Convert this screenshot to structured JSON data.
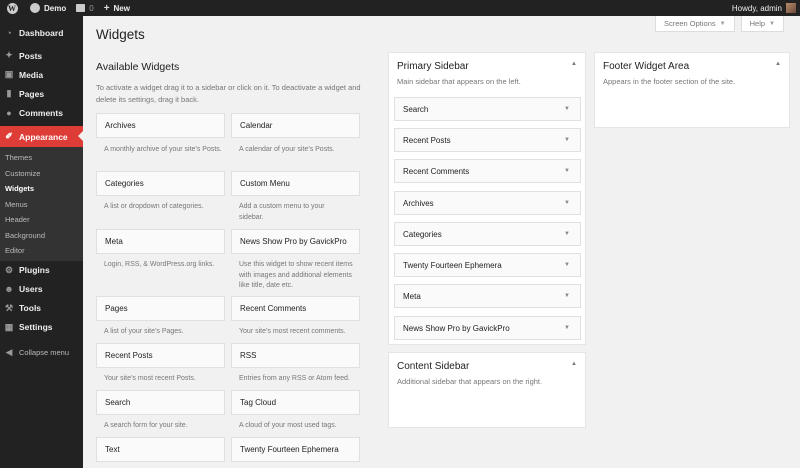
{
  "adminbar": {
    "site_name": "Demo",
    "comments_count": "0",
    "new_label": "New",
    "howdy": "Howdy, admin"
  },
  "sidebar": {
    "items_top": [
      {
        "label": "Dashboard",
        "icon": "dashboard-icon"
      }
    ],
    "items_mid": [
      {
        "label": "Posts",
        "icon": "pin-icon"
      },
      {
        "label": "Media",
        "icon": "media-icon"
      },
      {
        "label": "Pages",
        "icon": "page-icon"
      },
      {
        "label": "Comments",
        "icon": "comment-icon"
      }
    ],
    "appearance": "Appearance",
    "submenu": [
      "Themes",
      "Customize",
      "Widgets",
      "Menus",
      "Header",
      "Background",
      "Editor"
    ],
    "items_bottom": [
      {
        "label": "Plugins",
        "icon": "plugin-icon"
      },
      {
        "label": "Users",
        "icon": "user-icon"
      },
      {
        "label": "Tools",
        "icon": "wrench-icon"
      },
      {
        "label": "Settings",
        "icon": "settings-icon"
      }
    ],
    "collapse": "Collapse menu"
  },
  "screen_options": "Screen Options",
  "help": "Help",
  "page_title": "Widgets",
  "available": {
    "title": "Available Widgets",
    "description": "To activate a widget drag it to a sidebar or click on it. To deactivate a widget and delete its settings, drag it back.",
    "widgets": [
      {
        "name": "Archives",
        "desc": "A monthly archive of your site’s Posts."
      },
      {
        "name": "Calendar",
        "desc": "A calendar of your site’s Posts."
      },
      {
        "name": "Categories",
        "desc": "A list or dropdown of categories."
      },
      {
        "name": "Custom Menu",
        "desc": "Add a custom menu to your sidebar."
      },
      {
        "name": "Meta",
        "desc": "Login, RSS, & WordPress.org links."
      },
      {
        "name": "News Show Pro by GavickPro",
        "desc": "Use this widget to show recent items with images and additional elements like title, date etc."
      },
      {
        "name": "Pages",
        "desc": "A list of your site’s Pages."
      },
      {
        "name": "Recent Comments",
        "desc": "Your site’s most recent comments."
      },
      {
        "name": "Recent Posts",
        "desc": "Your site’s most recent Posts."
      },
      {
        "name": "RSS",
        "desc": "Entries from any RSS or Atom feed."
      },
      {
        "name": "Search",
        "desc": "A search form for your site."
      },
      {
        "name": "Tag Cloud",
        "desc": "A cloud of your most used tags."
      },
      {
        "name": "Text",
        "desc": ""
      },
      {
        "name": "Twenty Fourteen Ephemera",
        "desc": ""
      }
    ]
  },
  "primary_sidebar": {
    "title": "Primary Sidebar",
    "description": "Main sidebar that appears on the left.",
    "widgets": [
      "Search",
      "Recent Posts",
      "Recent Comments",
      "Archives",
      "Categories",
      "Twenty Fourteen Ephemera",
      "Meta",
      "News Show Pro by GavickPro"
    ]
  },
  "content_sidebar": {
    "title": "Content Sidebar",
    "description": "Additional sidebar that appears on the right."
  },
  "footer_area": {
    "title": "Footer Widget Area",
    "description": "Appears in the footer section of the site."
  }
}
